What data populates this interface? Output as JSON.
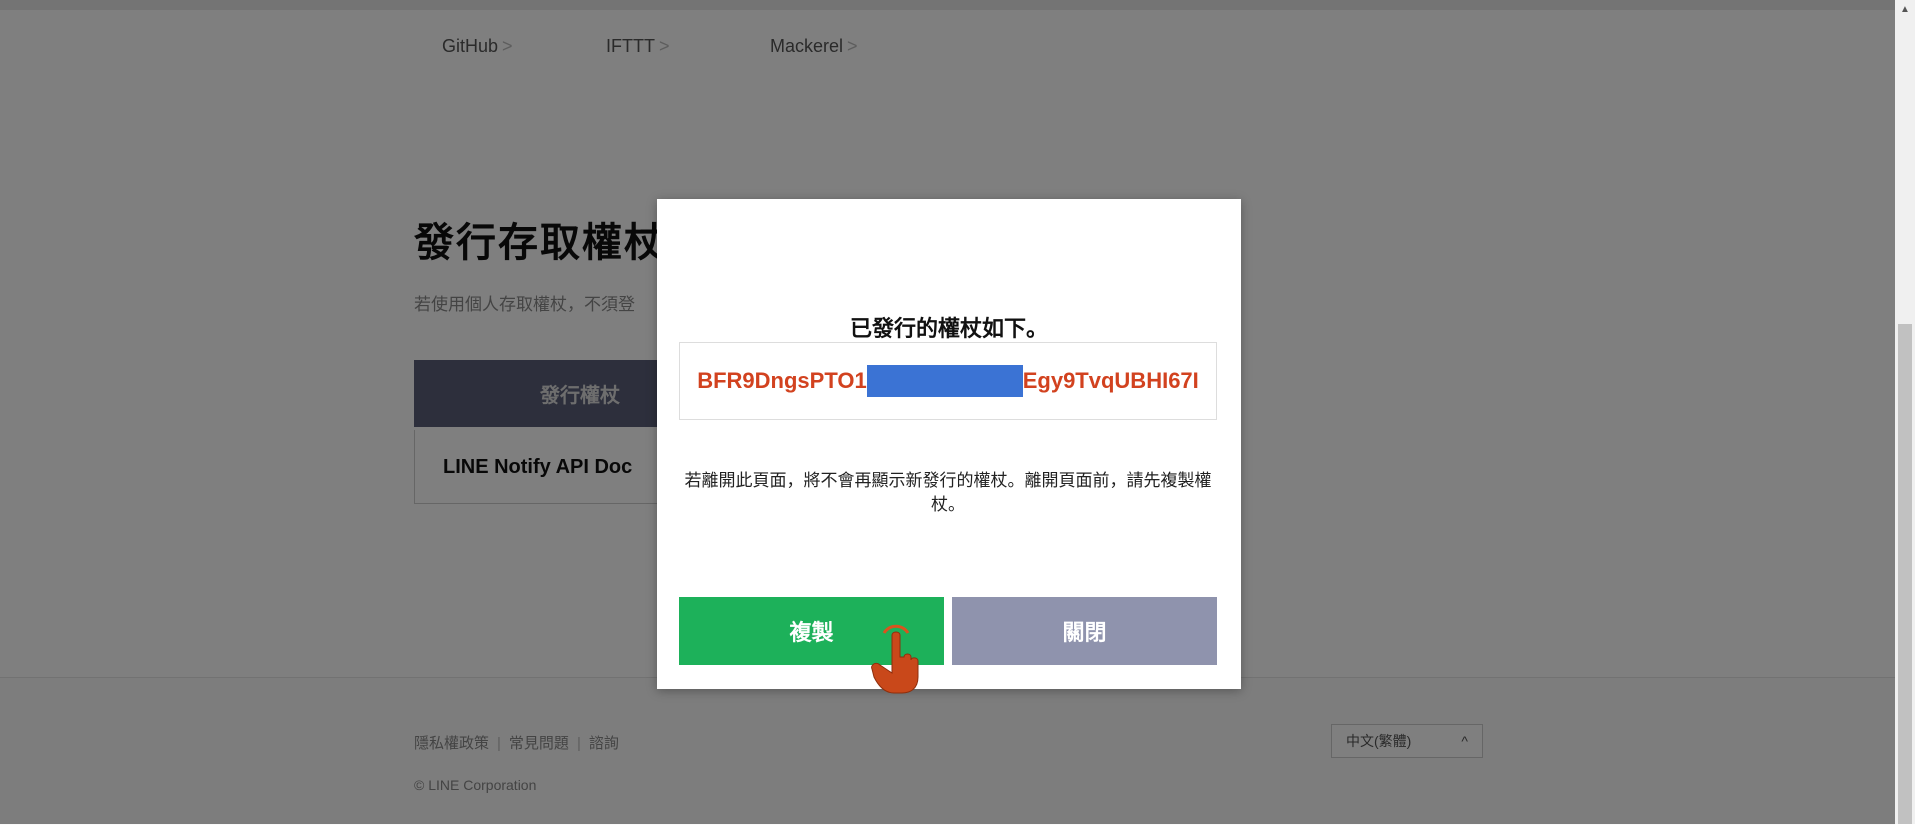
{
  "services": [
    {
      "label": "GitHub",
      "chevron": ">"
    },
    {
      "label": "IFTTT",
      "chevron": ">"
    },
    {
      "label": "Mackerel",
      "chevron": ">"
    }
  ],
  "page": {
    "title": "發行存取權杖",
    "subtitle": "若使用個人存取權杖，不須登",
    "issue_button": "發行權杖",
    "doc_link": "LINE Notify API Doc"
  },
  "modal": {
    "title": "已發行的權杖如下。",
    "token_prefix": "BFR9DngsPTO1",
    "token_suffix": "Egy9TvqUBHI67I",
    "warning": "若離開此頁面，將不會再顯示新發行的權杖。離開頁面前，請先複製權杖。",
    "copy_button": "複製",
    "close_button": "關閉"
  },
  "footer": {
    "links": [
      "隱私權政策",
      "常見問題",
      "諮詢"
    ],
    "separator": "|",
    "copyright": "© LINE Corporation",
    "language": "中文(繁體)",
    "language_arrow": "^"
  },
  "colors": {
    "token_red": "#d2421f",
    "copy_green": "#1db15a",
    "close_gray": "#8f93ad",
    "redact_blue": "#3b73d4"
  }
}
